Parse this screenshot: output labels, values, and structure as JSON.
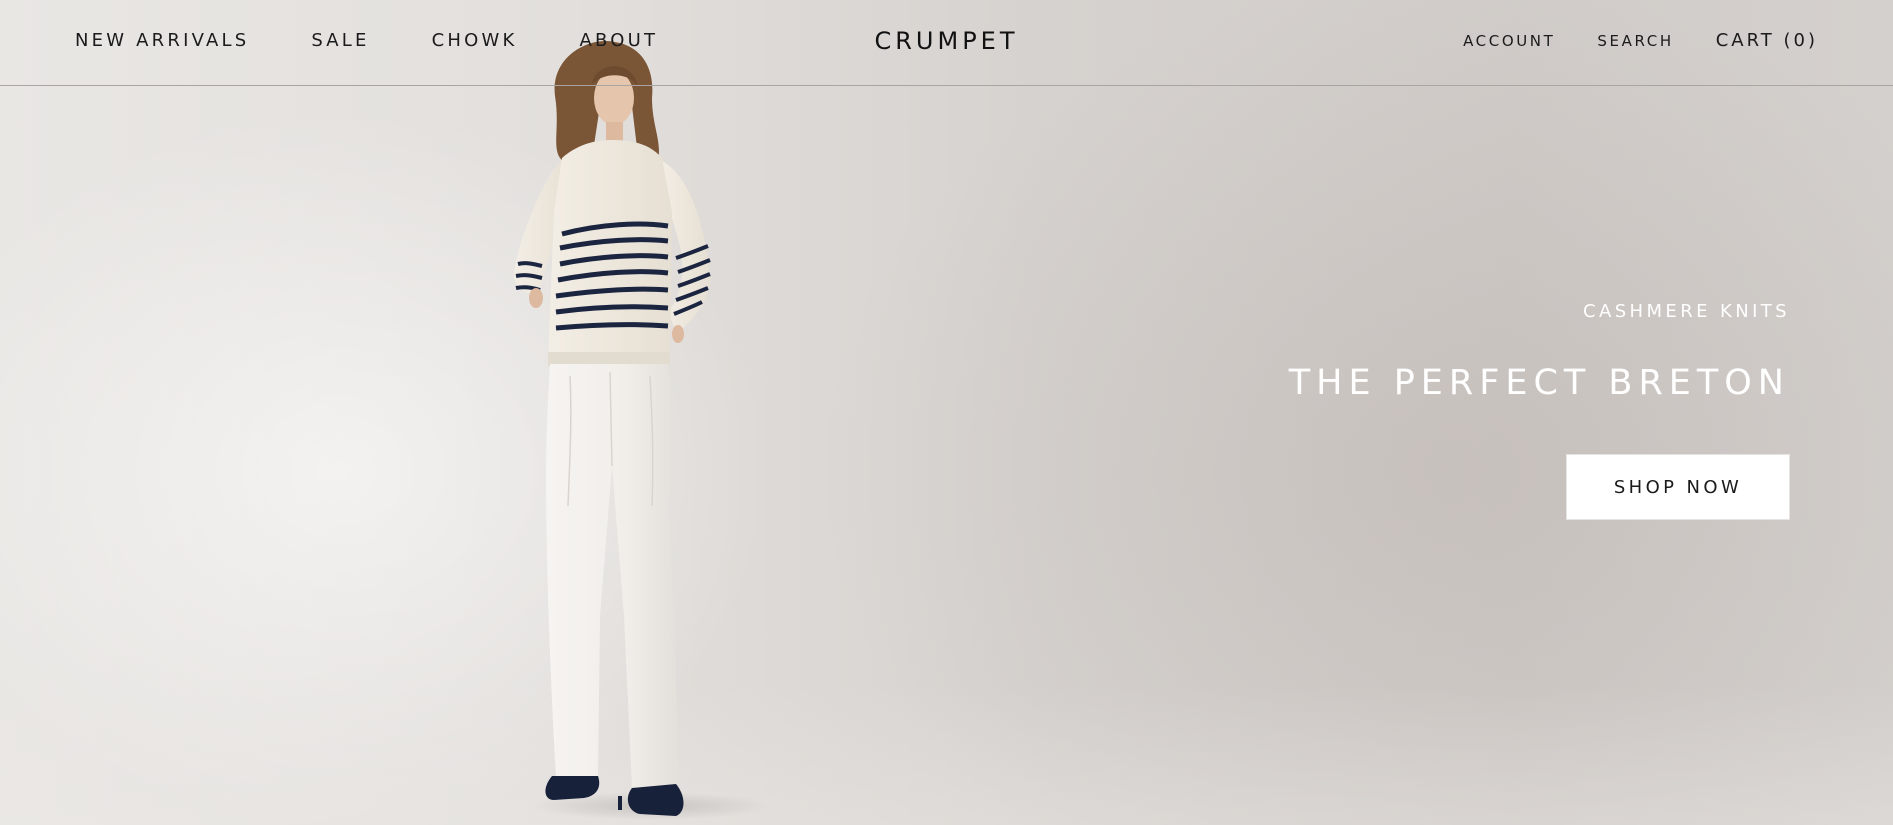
{
  "header": {
    "nav_left": [
      {
        "label": "NEW ARRIVALS"
      },
      {
        "label": "SALE"
      },
      {
        "label": "CHOWK"
      },
      {
        "label": "ABOUT"
      }
    ],
    "logo": "CRUMPET",
    "account_label": "ACCOUNT",
    "search_label": "SEARCH",
    "cart_label": "CART (0)"
  },
  "hero": {
    "eyebrow": "CASHMERE KNITS",
    "headline": "THE PERFECT BRETON",
    "cta_label": "SHOP NOW",
    "image_subject": "model-in-striped-breton-sweater",
    "colors": {
      "background": "#dcd8d5",
      "sweater": "#efe9df",
      "stripes": "#1c2540",
      "jeans": "#f3f1ee",
      "shoes": "#17213a",
      "hair": "#7a5536",
      "text": "#ffffff"
    }
  }
}
